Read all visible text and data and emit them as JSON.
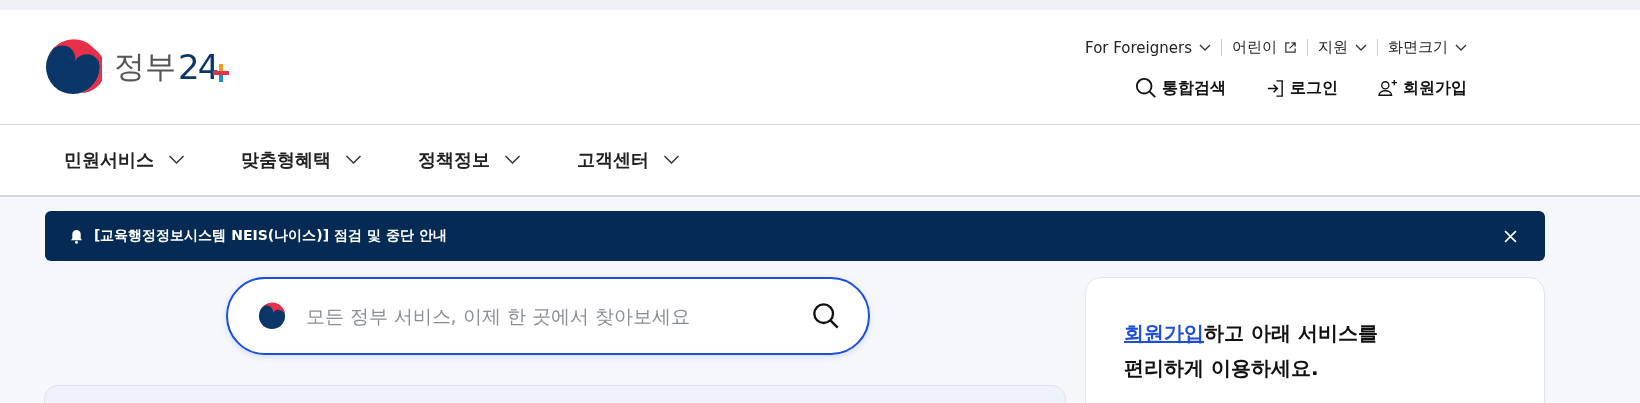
{
  "logo": {
    "text": "정부",
    "number": "24"
  },
  "utility_links": [
    {
      "label": "For Foreigners",
      "kind": "dropdown"
    },
    {
      "label": "어린이",
      "kind": "external"
    },
    {
      "label": "지원",
      "kind": "dropdown"
    },
    {
      "label": "화면크기",
      "kind": "dropdown"
    }
  ],
  "account_links": [
    {
      "label": "통합검색",
      "kind": "search"
    },
    {
      "label": "로그인",
      "kind": "login"
    },
    {
      "label": "회원가입",
      "kind": "signup"
    }
  ],
  "main_nav": [
    {
      "label": "민원서비스"
    },
    {
      "label": "맞춤형혜택"
    },
    {
      "label": "정책정보"
    },
    {
      "label": "고객센터"
    }
  ],
  "notice": {
    "text": "[교육행정정보시스템 NEIS(나이스)] 점검 및 중단 안내"
  },
  "search": {
    "placeholder": "모든 정부 서비스, 이제 한 곳에서 찾아보세요"
  },
  "signup_card": {
    "link": "회원가입",
    "text": "하고 아래 서비스를 편리하게 이용하세요."
  }
}
